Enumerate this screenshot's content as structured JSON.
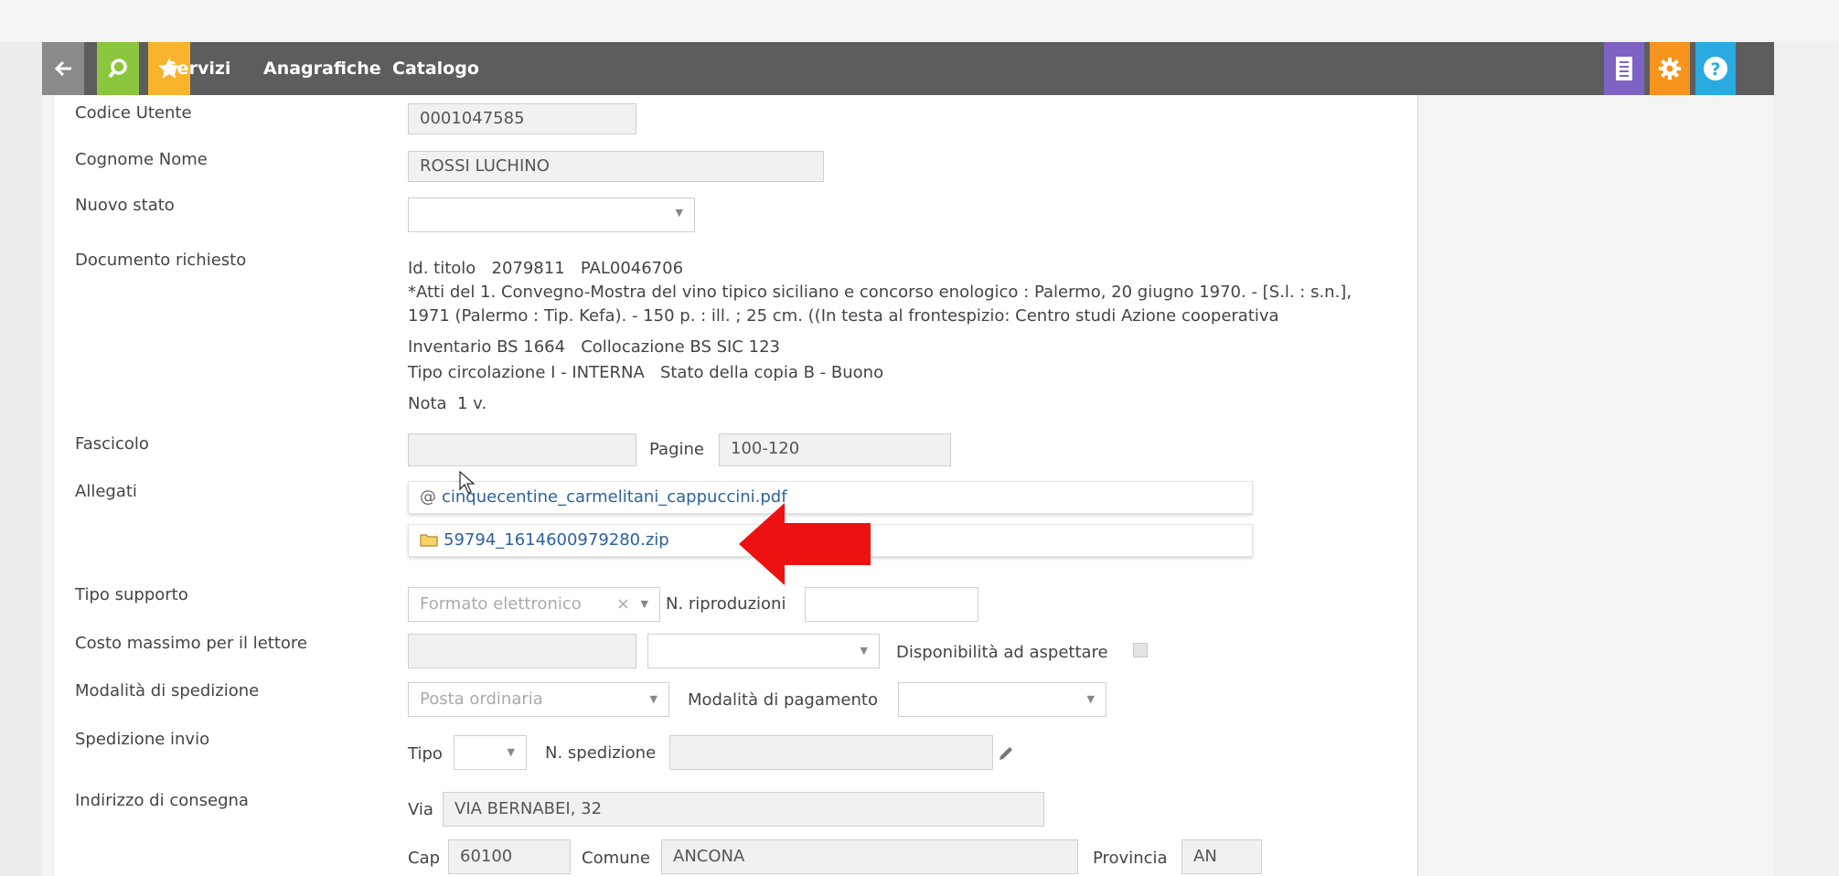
{
  "toolbar": {
    "menu": [
      "Servizi",
      "Anagrafiche",
      "Catalogo"
    ],
    "icons": {
      "back": "back-arrow-icon",
      "search": "search-icon",
      "star": "star-icon",
      "doc": "document-icon",
      "gear": "gear-icon",
      "help": "help-icon"
    },
    "colors": {
      "bar": "#5d5d5d",
      "search": "#8cc63f",
      "star": "#f7b42c",
      "doc": "#7f63c4",
      "gear": "#f7941d",
      "help": "#29aae1"
    }
  },
  "form": {
    "codice_utente": {
      "label": "Codice Utente",
      "value": "0001047585"
    },
    "cognome_nome": {
      "label": "Cognome Nome",
      "value": "ROSSI LUCHINO"
    },
    "nuovo_stato": {
      "label": "Nuovo stato",
      "value": ""
    },
    "documento": {
      "label": "Documento richiesto",
      "id_titolo": "Id. titolo   2079811   PAL0046706",
      "desc1": "*Atti del 1. Convegno-Mostra del vino tipico siciliano e concorso enologico : Palermo, 20 giugno 1970. - [S.l. : s.n.],",
      "desc2": "1971 (Palermo : Tip. Kefa). - 150 p. : ill. ; 25 cm. ((In testa al frontespizio: Centro studi Azione cooperativa",
      "inventario": "Inventario BS 1664   Collocazione BS SIC 123",
      "tipo_circ": "Tipo circolazione I - INTERNA   Stato della copia B - Buono",
      "nota": "Nota  1 v."
    },
    "fascicolo": {
      "label": "Fascicolo",
      "value": "",
      "pagine_label": "Pagine",
      "pagine_value": "100-120"
    },
    "allegati": {
      "label": "Allegati",
      "files": [
        "cinquecentine_carmelitani_cappuccini.pdf",
        "59794_1614600979280.zip"
      ]
    },
    "tipo_supporto": {
      "label": "Tipo supporto",
      "value": "Formato elettronico",
      "n_ripro_label": "N. riproduzioni",
      "n_ripro_value": ""
    },
    "costo": {
      "label": "Costo massimo per il lettore",
      "value": "",
      "currency": "",
      "disponibilita_label": "Disponibilità ad aspettare"
    },
    "spedizione": {
      "label": "Modalità di spedizione",
      "value": "Posta ordinaria",
      "pagamento_label": "Modalità di pagamento",
      "pagamento_value": ""
    },
    "invio": {
      "label": "Spedizione invio",
      "tipo_label": "Tipo",
      "tipo_value": "",
      "n_sped_label": "N. spedizione",
      "n_sped_value": ""
    },
    "indirizzo": {
      "label": "Indirizzo di consegna",
      "via_label": "Via",
      "via_value": "VIA BERNABEI, 32",
      "cap_label": "Cap",
      "cap_value": "60100",
      "comune_label": "Comune",
      "comune_value": "ANCONA",
      "provincia_label": "Provincia",
      "provincia_value": "AN"
    }
  },
  "annotation": {
    "arrow_color": "#ee1111"
  }
}
